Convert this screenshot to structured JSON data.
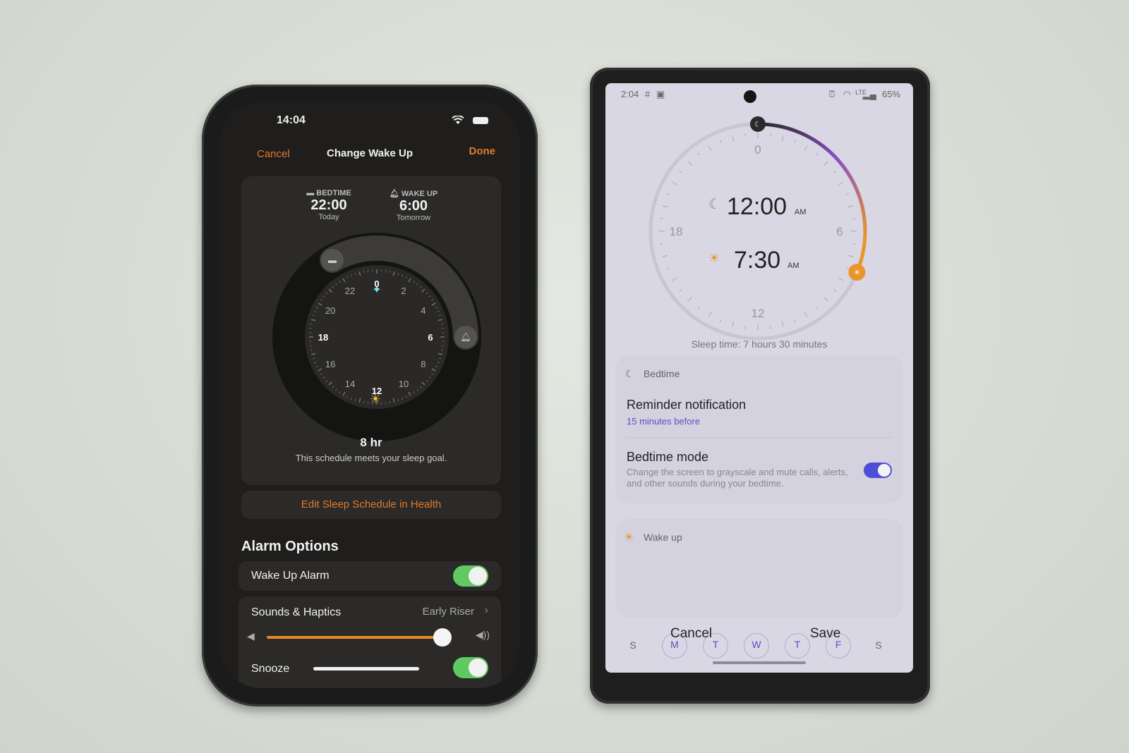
{
  "iphone": {
    "status": {
      "time": "14:04",
      "wifi_icon": "wifi-icon",
      "battery_icon": "battery-icon"
    },
    "nav": {
      "cancel": "Cancel",
      "title": "Change Wake Up",
      "done": "Done"
    },
    "schedule": {
      "bedtime": {
        "label": "BEDTIME",
        "time": "22:00",
        "day": "Today",
        "icon": "bed-icon"
      },
      "wakeup": {
        "label": "WAKE UP",
        "time": "6:00",
        "day": "Tomorrow",
        "icon": "bell-icon"
      }
    },
    "dial": {
      "hour_labels": [
        "0",
        "2",
        "4",
        "6",
        "8",
        "10",
        "12",
        "14",
        "16",
        "18",
        "20",
        "22"
      ],
      "bedtime_hour": 22,
      "wakeup_hour": 6
    },
    "duration": "8 hr",
    "goal_message": "This schedule meets your sleep goal.",
    "edit_link": "Edit Sleep Schedule in Health",
    "alarm_options": {
      "title": "Alarm Options",
      "wake_up_alarm": {
        "label": "Wake Up Alarm",
        "enabled": true
      },
      "sounds": {
        "label": "Sounds & Haptics",
        "value": "Early Riser"
      },
      "volume": 0.95,
      "snooze": {
        "label": "Snooze",
        "enabled": true
      }
    },
    "colors": {
      "accent": "#e07a2e",
      "toggle_on": "#5fca62"
    }
  },
  "android": {
    "status": {
      "time": "2:04",
      "battery": "65%"
    },
    "dial": {
      "hour_labels": [
        "0",
        "6",
        "12",
        "18"
      ],
      "bedtime": {
        "time": "12:00",
        "ampm": "AM"
      },
      "wakeup": {
        "time": "7:30",
        "ampm": "AM"
      },
      "bedtime_hour": 0,
      "wakeup_hour": 7.5
    },
    "sleep_time": "Sleep time: 7 hours 30 minutes",
    "bedtime_section": {
      "header": "Bedtime",
      "reminder": {
        "label": "Reminder notification",
        "value": "15 minutes before"
      },
      "mode": {
        "label": "Bedtime mode",
        "description": "Change the screen to grayscale and mute calls, alerts, and other sounds during your bedtime.",
        "enabled": true
      }
    },
    "wakeup_section": {
      "header": "Wake up",
      "days": [
        {
          "label": "S",
          "selected": false
        },
        {
          "label": "M",
          "selected": true
        },
        {
          "label": "T",
          "selected": true
        },
        {
          "label": "W",
          "selected": true
        },
        {
          "label": "T",
          "selected": true
        },
        {
          "label": "F",
          "selected": true
        },
        {
          "label": "S",
          "selected": false
        }
      ]
    },
    "buttons": {
      "cancel": "Cancel",
      "save": "Save"
    },
    "colors": {
      "accent": "#5a4fc4",
      "toggle_on": "#4c4fd6",
      "sun": "#e9952a"
    }
  }
}
